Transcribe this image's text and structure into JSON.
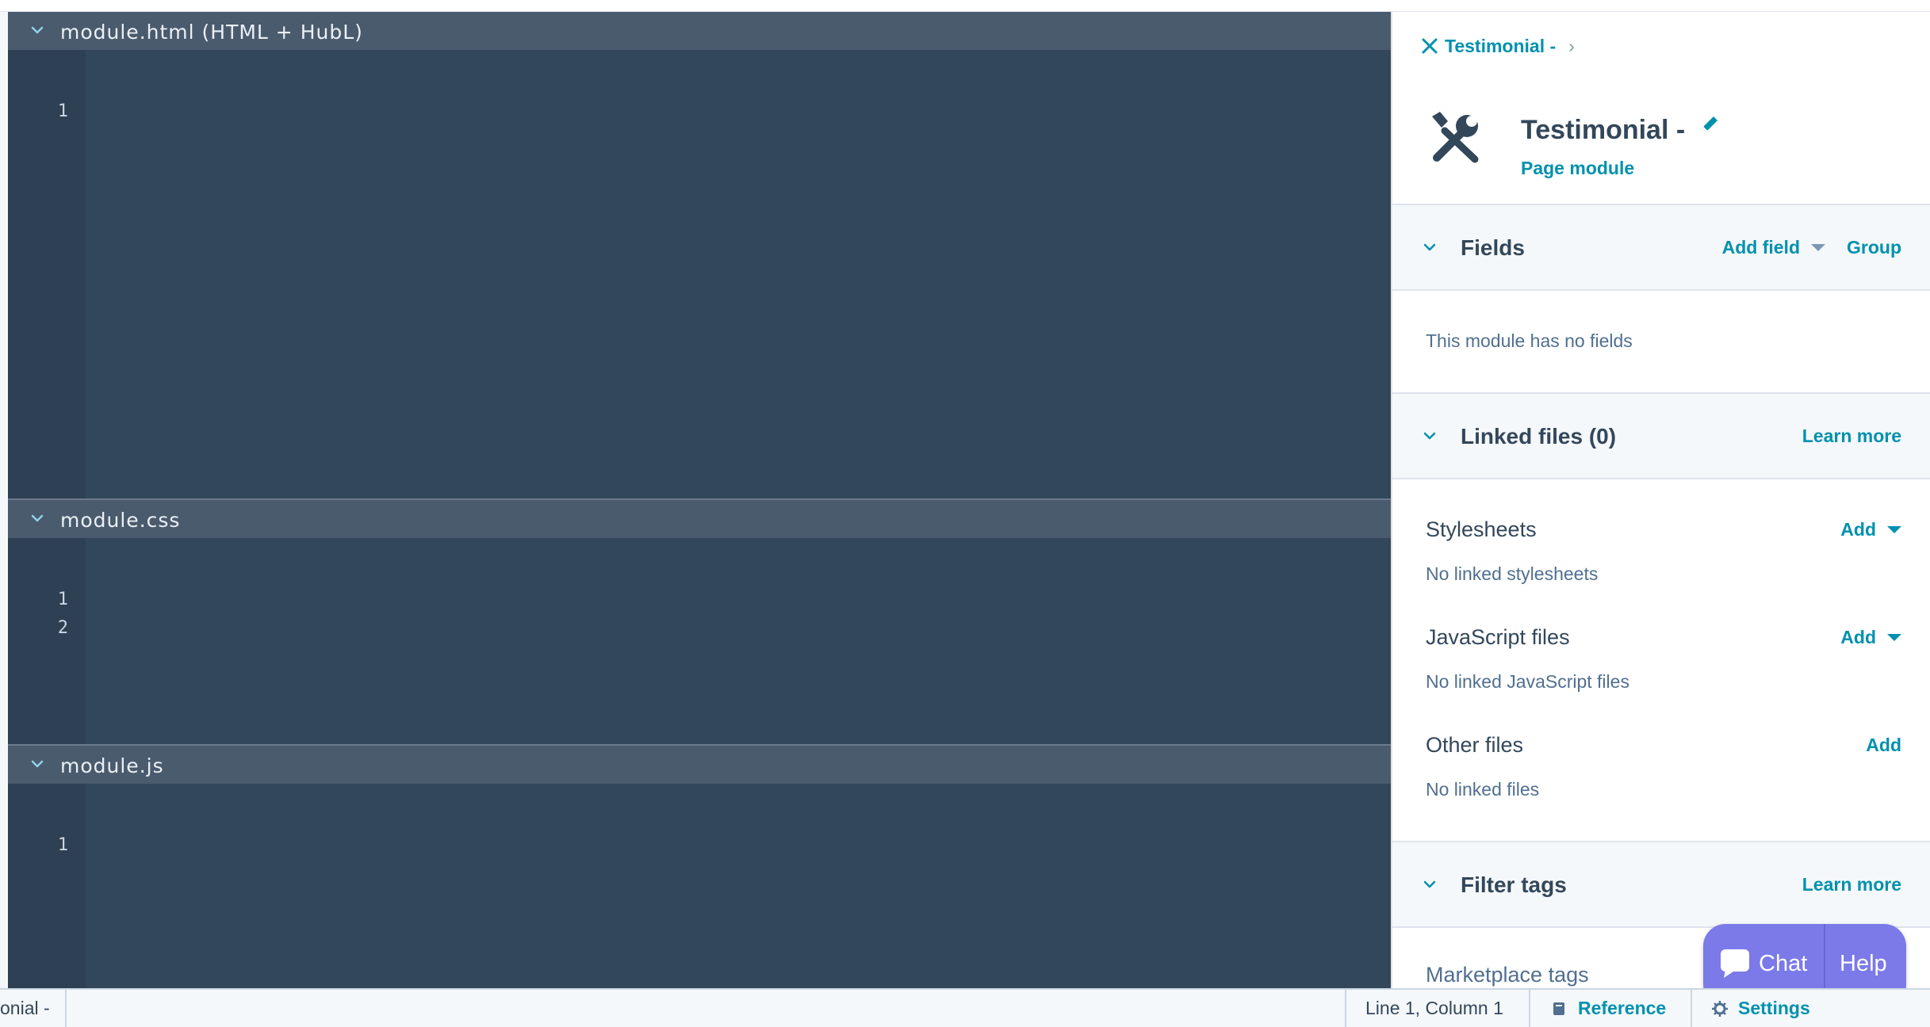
{
  "editors": [
    {
      "filename": "module.html (HTML + HubL)",
      "line_numbers": [
        "1"
      ]
    },
    {
      "filename": "module.css",
      "line_numbers": [
        "1",
        "2"
      ]
    },
    {
      "filename": "module.js",
      "line_numbers": [
        "1"
      ]
    }
  ],
  "sidebar": {
    "breadcrumb": {
      "label": "Testimonial -",
      "separator": "›"
    },
    "module": {
      "title": "Testimonial -",
      "type": "Page module"
    },
    "fields": {
      "title": "Fields",
      "add_field_label": "Add field",
      "group_label": "Group",
      "empty_text": "This module has no fields"
    },
    "linked_files": {
      "title": "Linked files (0)",
      "learn_more": "Learn more",
      "stylesheets": {
        "title": "Stylesheets",
        "add_label": "Add",
        "empty_text": "No linked stylesheets"
      },
      "javascript": {
        "title": "JavaScript files",
        "add_label": "Add",
        "empty_text": "No linked JavaScript files"
      },
      "other": {
        "title": "Other files",
        "add_label": "Add",
        "empty_text": "No linked files"
      }
    },
    "filter_tags": {
      "title": "Filter tags",
      "learn_more": "Learn more",
      "marketplace_tags": "Marketplace tags"
    }
  },
  "chat_widget": {
    "chat_label": "Chat",
    "help_label": "Help"
  },
  "status_bar": {
    "file_label": "onial -",
    "cursor": "Line 1, Column 1",
    "reference_label": "Reference",
    "settings_label": "Settings"
  },
  "colors": {
    "editor_bg": "#33475b",
    "editor_header_bg": "#4b5b6e",
    "link": "#0091ae",
    "text": "#33475b",
    "chat_bg": "#7b7ae8"
  }
}
